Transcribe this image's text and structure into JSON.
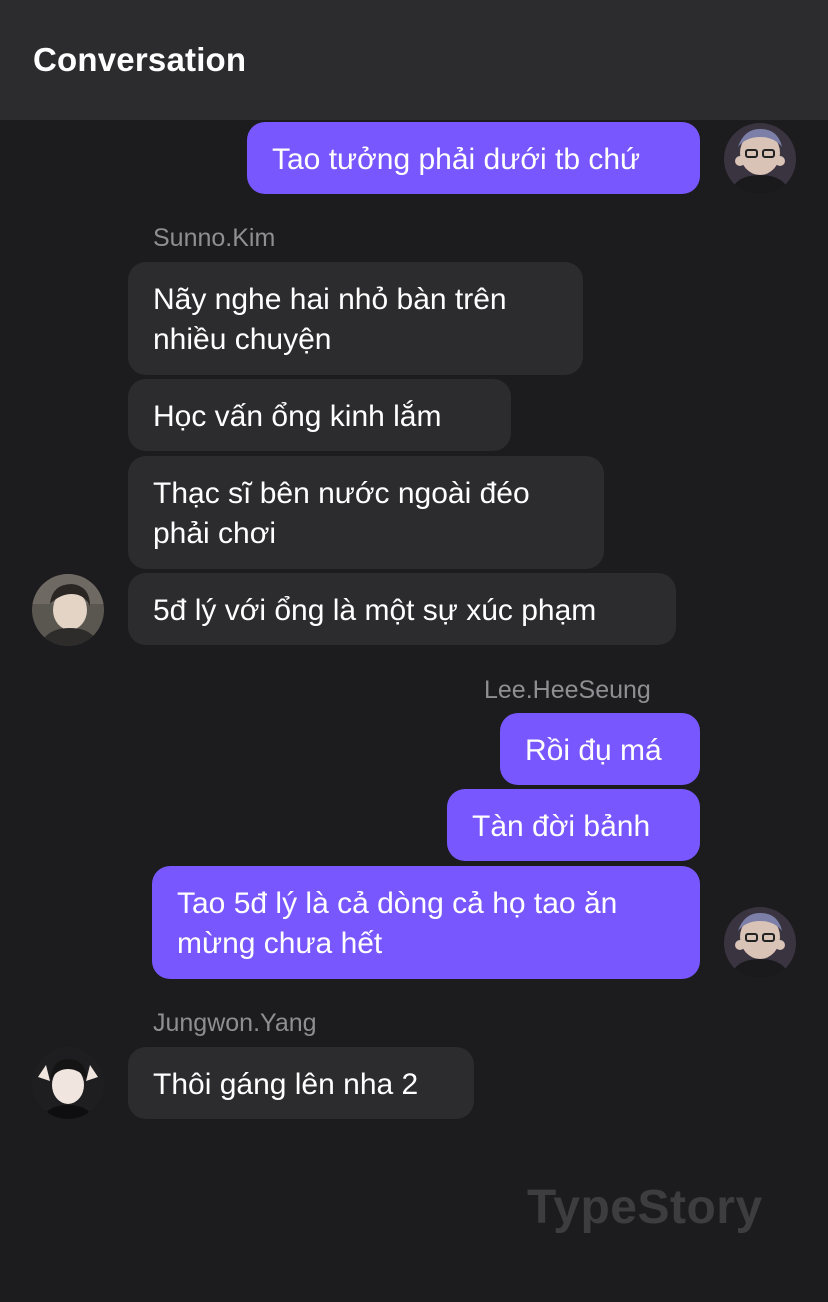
{
  "header": {
    "title": "Conversation"
  },
  "messages": {
    "m1": "Tao tưởng phải dưới tb chứ",
    "m2_line1": "Nãy nghe hai nhỏ bàn trên",
    "m2_line2": "nhiều chuyện",
    "m3": "Học vấn ổng kinh lắm",
    "m4_line1": "Thạc sĩ bên nước ngoài đéo",
    "m4_line2": "phải chơi",
    "m5": "5đ lý với ổng là một sự xúc phạm",
    "m6": "Rồi đụ má",
    "m7": "Tàn đời bảnh",
    "m8_line1": "Tao 5đ lý là cả dòng cả họ tao ăn",
    "m8_line2": "mừng chưa hết",
    "m9": "Thôi gáng lên nha 2"
  },
  "senders": {
    "sunno": "Sunno.Kim",
    "lee": "Lee.HeeSeung",
    "jungwon": "Jungwon.Yang"
  },
  "watermark": "TypeStory",
  "colors": {
    "background": "#1c1c1e",
    "header": "#2c2c2e",
    "incoming_bubble": "#2c2c2e",
    "outgoing_bubble": "#7857ff",
    "sender_name": "#8e8e93"
  }
}
